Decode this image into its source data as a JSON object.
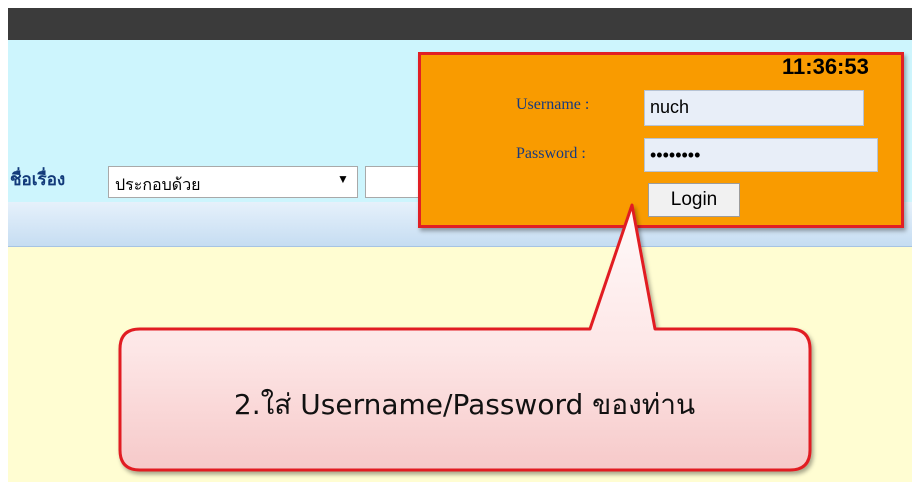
{
  "header": {
    "search_label": "ชื่อเรื่อง",
    "search_select_value": "ประกอบด้วย",
    "select_arrow": "▼"
  },
  "login": {
    "clock": "11:36:53",
    "username_label": "Username :",
    "username_value": "nuch",
    "password_label": "Password :",
    "password_value": "••••••••",
    "login_button": "Login"
  },
  "callout": {
    "text": "2.ใส่ Username/Password ของท่าน"
  },
  "colors": {
    "topbar": "#3b3b3b",
    "header_bg": "#cdf5fd",
    "login_panel": "#f99b00",
    "login_border": "#e11f24",
    "content_bg": "#fffdd2",
    "callout_fill": "#fde2e2",
    "callout_border": "#e11f24"
  }
}
